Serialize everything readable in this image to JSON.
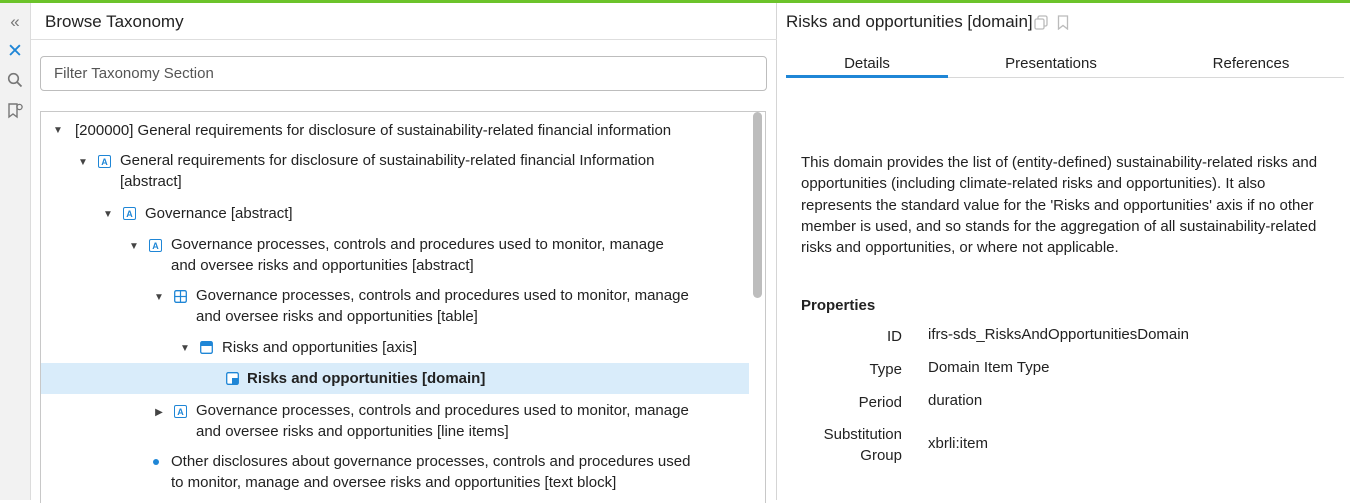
{
  "left": {
    "title": "Browse Taxonomy",
    "filter_placeholder": "Filter Taxonomy Section"
  },
  "tree": [
    {
      "text": "[200000] General requirements for disclosure of sustainability-related financial information",
      "icon": "none",
      "toggle": "expanded"
    },
    {
      "text": "General requirements for disclosure of sustainability-related financial Information [abstract]",
      "icon": "abstract",
      "toggle": "expanded"
    },
    {
      "text": "Governance [abstract]",
      "icon": "abstract",
      "toggle": "expanded"
    },
    {
      "text": "Governance processes, controls and procedures used to monitor, manage and oversee risks and opportunities [abstract]",
      "icon": "abstract",
      "toggle": "expanded"
    },
    {
      "text": "Governance processes, controls and procedures used to monitor, manage and oversee risks and opportunities [table]",
      "icon": "table",
      "toggle": "expanded"
    },
    {
      "text": "Risks and opportunities [axis]",
      "icon": "axis",
      "toggle": "expanded"
    },
    {
      "text": "Risks and opportunities [domain]",
      "icon": "domain",
      "toggle": "none",
      "selected": true
    },
    {
      "text": "Governance processes, controls and procedures used to monitor, manage and oversee risks and opportunities [line items]",
      "icon": "abstract",
      "toggle": "collapsed"
    },
    {
      "text": "Other disclosures about governance processes, controls and procedures used to monitor, manage and oversee risks and opportunities [text block]",
      "icon": "dot",
      "toggle": "none"
    }
  ],
  "right": {
    "title": "Risks and opportunities [domain]",
    "tabs": [
      "Details",
      "Presentations",
      "References"
    ],
    "active_tab": "Details",
    "description": "This domain provides the list of (entity-defined) sustainability-related risks and opportunities (including climate-related risks and opportunities). It also represents the standard value for the 'Risks and opportunities' axis if no other member is used, and so stands for the aggregation of all sustainability-related risks and opportunities, or where not applicable.",
    "properties_title": "Properties",
    "properties": [
      {
        "label": "ID",
        "value": "ifrs-sds_RisksAndOpportunitiesDomain"
      },
      {
        "label": "Type",
        "value": "Domain Item Type"
      },
      {
        "label": "Period",
        "value": "duration"
      },
      {
        "label": "Substitution Group",
        "value": "xbrli:item"
      }
    ]
  },
  "colors": {
    "accent": "#1f86d6",
    "top_bar": "#6cc32a",
    "selection": "#d9ecfa"
  }
}
